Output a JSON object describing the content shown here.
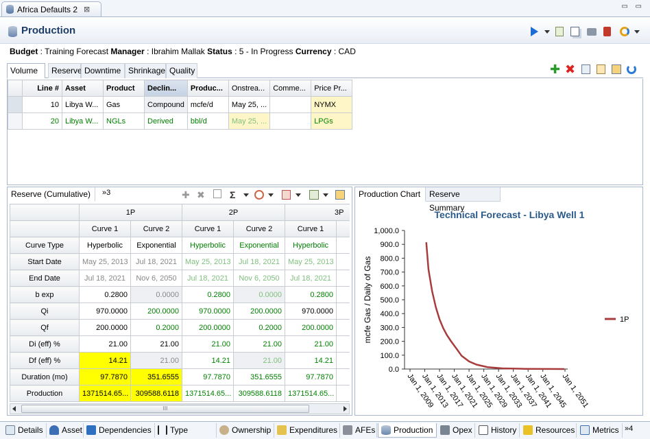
{
  "editor": {
    "tab_title": "Africa Defaults 2",
    "close": "⊠"
  },
  "page": {
    "title": "Production"
  },
  "info": {
    "budget_label": "Budget",
    "budget_value": " : Training Forecast ",
    "manager_label": "Manager",
    "manager_value": " : Ibrahim Mallak ",
    "status_label": "Status",
    "status_value": " : 5 - In Progress ",
    "currency_label": "Currency",
    "currency_value": " : CAD"
  },
  "inner_tabs": [
    "Volume",
    "Reserve",
    "Downtime",
    "Shrinkage",
    "Quality"
  ],
  "volume_table": {
    "headers": [
      "Line #",
      "Asset",
      "Product",
      "Declin...",
      "Produc...",
      "Onstrea...",
      "Comme...",
      "Price Pr..."
    ],
    "rows": [
      [
        "10",
        "Libya W...",
        "Gas",
        "Compound",
        "mcfe/d",
        "May 25, ...",
        "",
        "NYMX"
      ],
      [
        "20",
        "Libya W...",
        "NGLs",
        "Derived",
        "bbl/d",
        "May 25, ...",
        "",
        "LPGs"
      ]
    ]
  },
  "reserve_panel": {
    "tab_label": "Reserve (Cumulative)",
    "overflow_label": "»3",
    "groups": [
      "1P",
      "2P",
      "3P"
    ],
    "curves": [
      "Curve 1",
      "Curve 2",
      "Curve 1",
      "Curve 2",
      "Curve 1"
    ],
    "rows": [
      {
        "label": "Curve Type",
        "cells": [
          "Hyperbolic",
          "Exponential",
          "Hyperbolic",
          "Exponential",
          "Hyperbolic",
          "E"
        ]
      },
      {
        "label": "Start Date",
        "cells": [
          "May 25, 2013",
          "Jul 18, 2021",
          "May 25, 2013",
          "Jul 18, 2021",
          "May 25, 2013",
          "Ju"
        ]
      },
      {
        "label": "End Date",
        "cells": [
          "Jul 18, 2021",
          "Nov 6, 2050",
          "Jul 18, 2021",
          "Nov 6, 2050",
          "Jul 18, 2021",
          "N"
        ]
      },
      {
        "label": "b exp",
        "cells": [
          "0.2800",
          "0.0000",
          "0.2800",
          "0.0000",
          "0.2800",
          ""
        ]
      },
      {
        "label": "Qi",
        "cells": [
          "970.0000",
          "200.0000",
          "970.0000",
          "200.0000",
          "970.0000",
          ""
        ]
      },
      {
        "label": "Qf",
        "cells": [
          "200.0000",
          "0.2000",
          "200.0000",
          "0.2000",
          "200.0000",
          ""
        ]
      },
      {
        "label": "Di (eff) %",
        "cells": [
          "21.00",
          "21.00",
          "21.00",
          "21.00",
          "21.00",
          ""
        ]
      },
      {
        "label": "Df (eff) %",
        "cells": [
          "14.21",
          "21.00",
          "14.21",
          "21.00",
          "14.21",
          ""
        ]
      },
      {
        "label": "Duration (mo)",
        "cells": [
          "97.7870",
          "351.6555",
          "97.7870",
          "351.6555",
          "97.7870",
          ""
        ]
      },
      {
        "label": "Production",
        "cells": [
          "1371514.65...",
          "309588.6118",
          "1371514.65...",
          "309588.6118",
          "1371514.65...",
          "30"
        ]
      }
    ]
  },
  "chart_panel": {
    "tabs": [
      "Production Chart",
      "Reserve Summary"
    ]
  },
  "chart_data": {
    "type": "line",
    "title": "Technical Forecast - Libya Well 1",
    "xlabel": "",
    "ylabel": "mcfe Gas / Daily of Gas",
    "ylim": [
      0,
      1000
    ],
    "yticks": [
      "0.0",
      "100.0",
      "200.0",
      "300.0",
      "400.0",
      "500.0",
      "600.0",
      "700.0",
      "800.0",
      "900.0",
      "1,000.0"
    ],
    "xticks": [
      "Jan 1, 2009",
      "Jan 1, 2013",
      "Jan 1, 2017",
      "Jan 1, 2021",
      "Jan 1, 2025",
      "Jan 1, 2029",
      "Jan 1, 2033",
      "Jan 1, 2037",
      "Jan 1, 2041",
      "Jan 1, 2045",
      "Jan 1, 2051"
    ],
    "legend_placement": "right",
    "color": "#a83c3c",
    "series": [
      {
        "name": "1P",
        "x": [
          2013.4,
          2014,
          2015,
          2016,
          2017,
          2018,
          2019,
          2020,
          2021.5,
          2023,
          2025,
          2027,
          2030,
          2034,
          2040,
          2046,
          2050.8
        ],
        "values": [
          915,
          720,
          560,
          445,
          360,
          295,
          245,
          205,
          150,
          95,
          55,
          32,
          14,
          5,
          1.5,
          0.5,
          0.2
        ]
      }
    ]
  },
  "bottom_tabs": [
    "Details",
    "Asset",
    "Dependencies",
    "Type Curves",
    "Ownership",
    "Expenditures",
    "AFEs",
    "Production",
    "Opex",
    "History",
    "Resources",
    "Metrics",
    "»4"
  ]
}
